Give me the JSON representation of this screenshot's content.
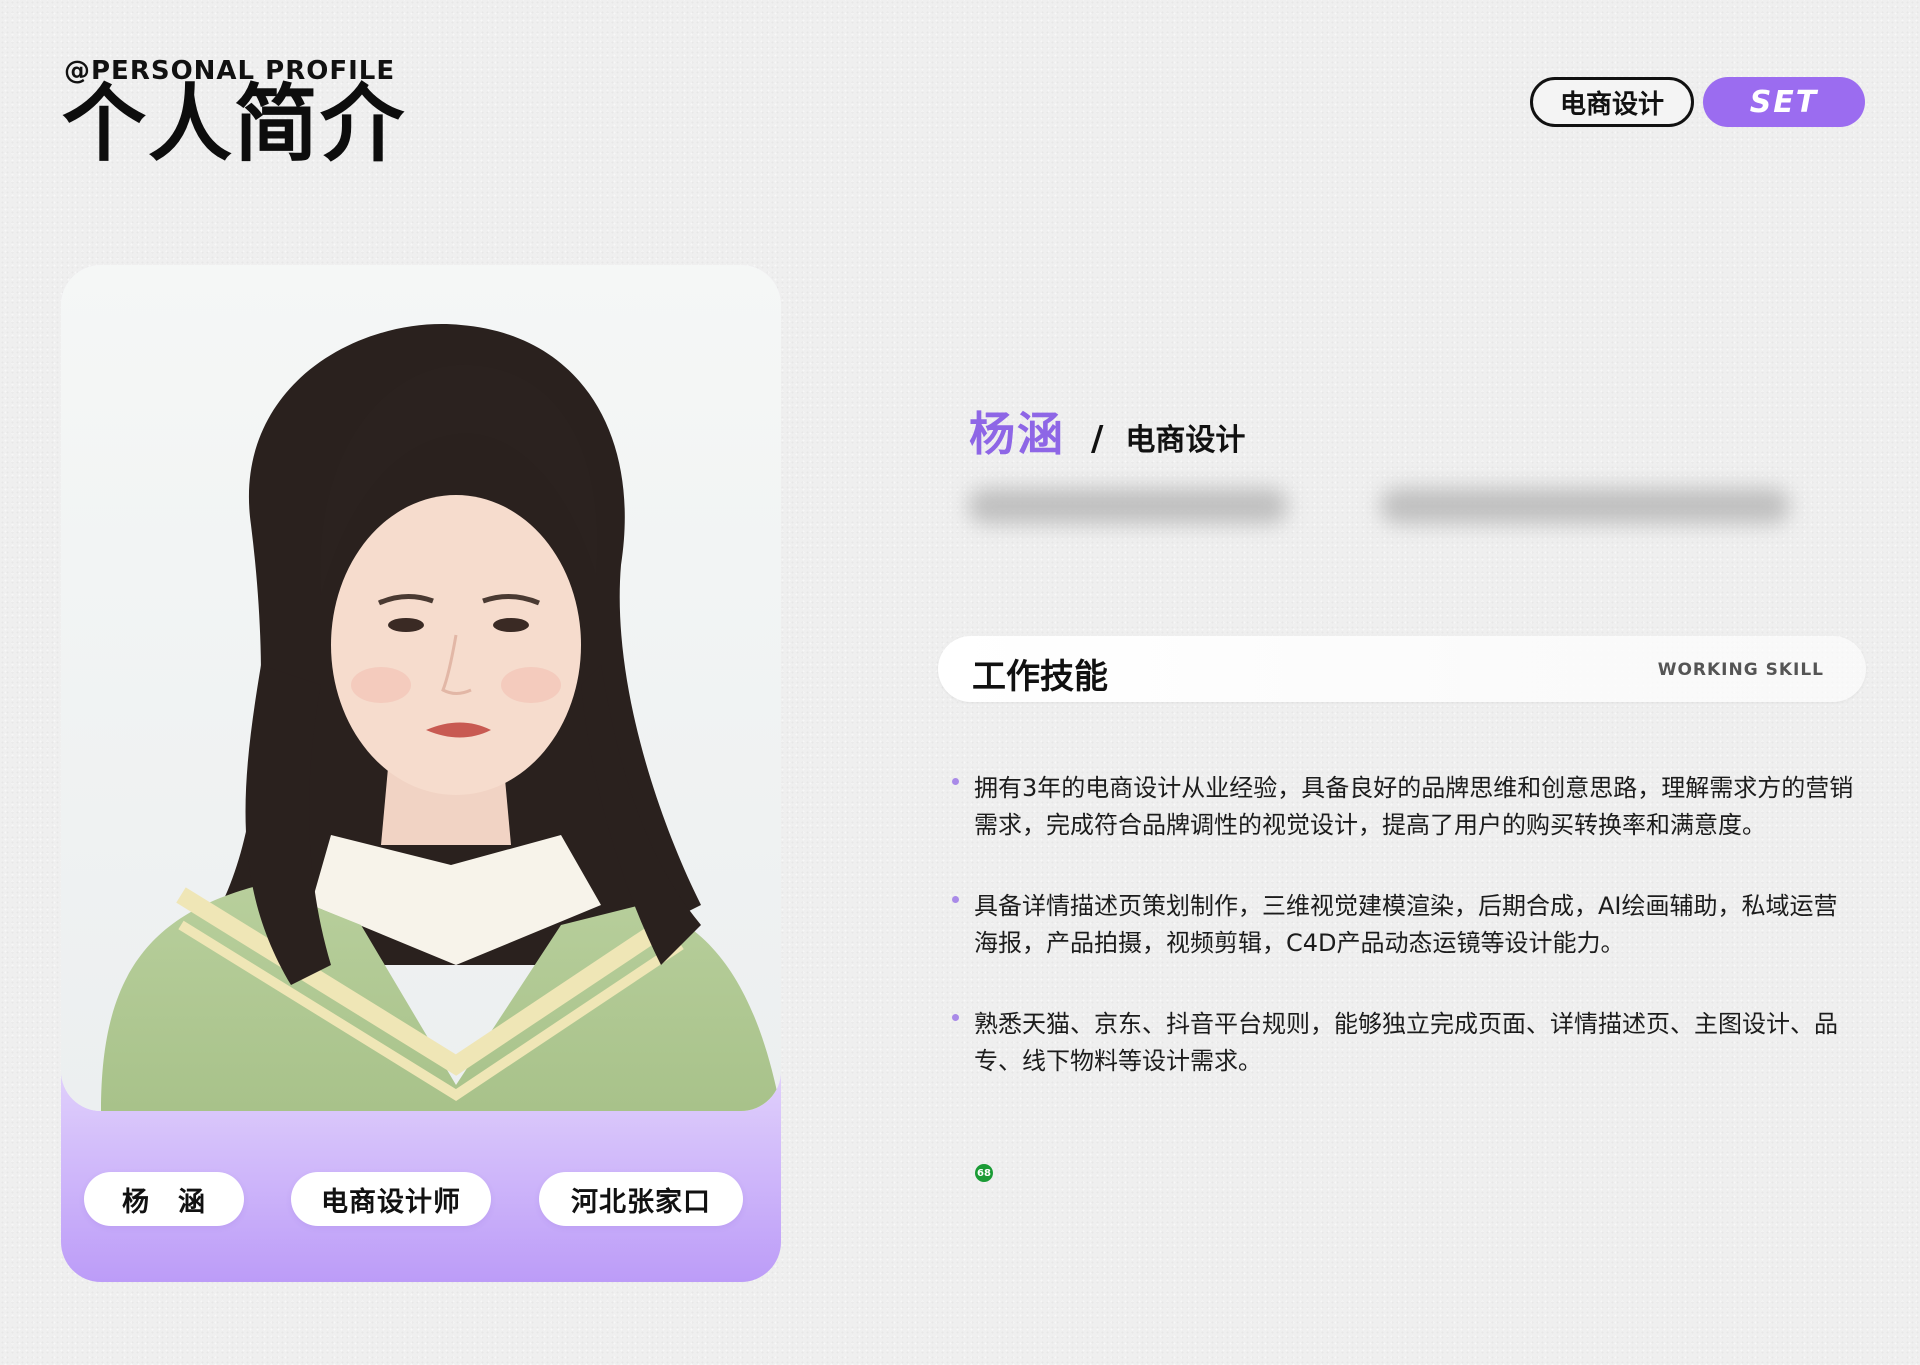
{
  "header": {
    "eyebrow": "@PERSONAL PROFILE",
    "title": "个人简介",
    "tag_outline": "电商设计",
    "tag_filled": "SET"
  },
  "card": {
    "photo_alt": "portrait",
    "chips": [
      "杨　涵",
      "电商设计师",
      "河北张家口"
    ]
  },
  "profile": {
    "name": "杨涵",
    "slash": "/",
    "role": "电商设计"
  },
  "skills": {
    "title": "工作技能",
    "subtitle": "WORKING SKILL",
    "items": [
      "拥有3年的电商设计从业经验，具备良好的品牌思维和创意思路，理解需求方的营销需求，完成符合品牌调性的视觉设计，提高了用户的购买转换率和满意度。",
      "具备详情描述页策划制作，三维视觉建模渲染，后期合成，AI绘画辅助，私域运营海报，产品拍摄，视频剪辑，C4D产品动态运镜等设计能力。",
      "熟悉天猫、京东、抖音平台规则，能够独立完成页面、详情描述页、主图设计、品专、线下物料等设计需求。"
    ]
  },
  "badge": "68",
  "colors": {
    "accent": "#9b6cf0",
    "name": "#8e66e6",
    "background": "#efefef",
    "bullet_dot": "#a98ae8",
    "badge": "#1a9b35"
  }
}
